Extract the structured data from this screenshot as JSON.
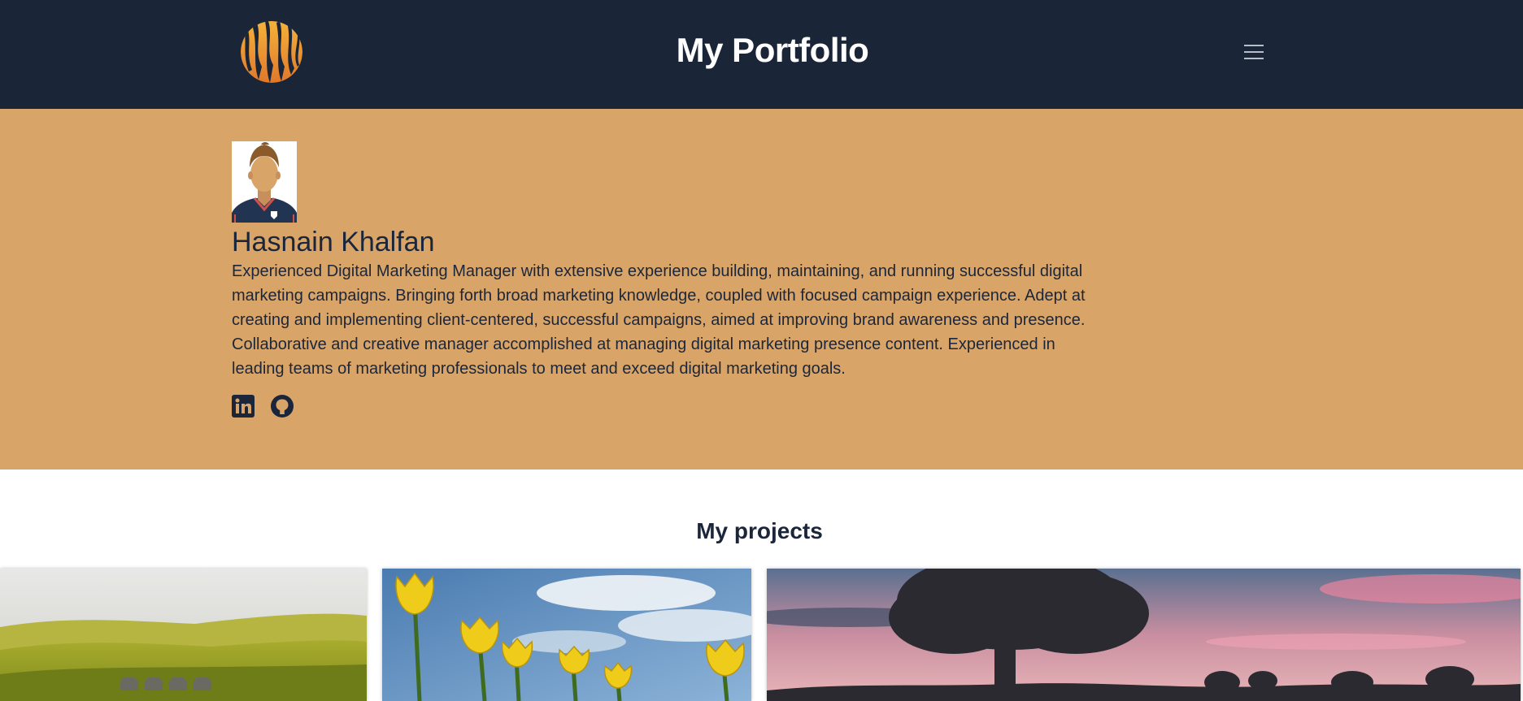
{
  "header": {
    "title": "My Portfolio",
    "logo_icon": "tiger-stripe-logo-icon",
    "menu_icon": "hamburger-menu-icon",
    "background_color": "#1b2538"
  },
  "hero": {
    "background_color": "#d8a468",
    "avatar_icon": "profile-avatar-icon",
    "name": "Hasnain Khalfan",
    "bio": "Experienced Digital Marketing Manager with extensive experience building, maintaining, and running successful digital marketing campaigns. Bringing forth broad marketing knowledge, coupled with focused campaign experience. Adept at creating and implementing client-centered, successful campaigns, aimed at improving brand awareness and presence. Collaborative and creative manager accomplished at managing digital marketing presence content. Experienced in leading teams of marketing professionals to meet and exceed digital marketing goals.",
    "social": [
      {
        "icon": "linkedin-icon"
      },
      {
        "icon": "github-icon"
      }
    ]
  },
  "projects": {
    "title": "My projects",
    "cards": [
      {
        "image": "green-hills-barns-image"
      },
      {
        "image": "yellow-tulips-image"
      },
      {
        "image": "tree-sunset-image"
      }
    ]
  }
}
